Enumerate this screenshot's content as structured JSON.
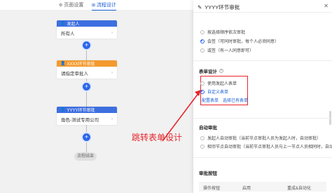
{
  "tabs": [
    {
      "label": "页面设置",
      "icon": "gear-icon"
    },
    {
      "label": "流程设计",
      "icon": "flow-icon"
    }
  ],
  "flow": {
    "nodes": [
      {
        "title": "发起人",
        "body": "所有人",
        "color": "#3d6fe0"
      },
      {
        "title": "XXXX环节审批",
        "body": "请指定审批人",
        "color": "#f39a2e"
      },
      {
        "title": "YYYY环节审批",
        "body": "角色-测试专用公司",
        "color": "#3d6fe0"
      }
    ],
    "end_label": "流程结束"
  },
  "annotation": "跳转表单设计",
  "panel": {
    "title": "YYYY环节审批",
    "approval_mode": {
      "options": [
        {
          "label": "按选择顺序依次审批",
          "selected": false
        },
        {
          "label": "会签（可同时审批，每个人必须同意）",
          "selected": true
        },
        {
          "label": "或签（有一人同意即可）",
          "selected": false
        }
      ]
    },
    "form_design": {
      "title": "表单设计",
      "options": [
        {
          "label": "使用发起人表单",
          "selected": false
        },
        {
          "label": "自定义表单",
          "selected": true
        }
      ],
      "config_link": "配置表单",
      "choose_link": "选择已有表单"
    },
    "auto_approve": {
      "title": "自动审批",
      "options": [
        {
          "label": "发起人自动审批（当前节点审批人员为发起人时，自动审批）"
        },
        {
          "label": "相邻节点自动审批（当前节点审批人员与上一节点人员相同时，自动审批）"
        }
      ]
    },
    "buttons_section": {
      "title": "审批按钮",
      "columns": [
        "操作按钮",
        "启用",
        "重成&自动化"
      ]
    }
  },
  "colors": {
    "accent": "#2d66ea",
    "annotation": "#e8242b",
    "orange": "#f39a2e"
  }
}
